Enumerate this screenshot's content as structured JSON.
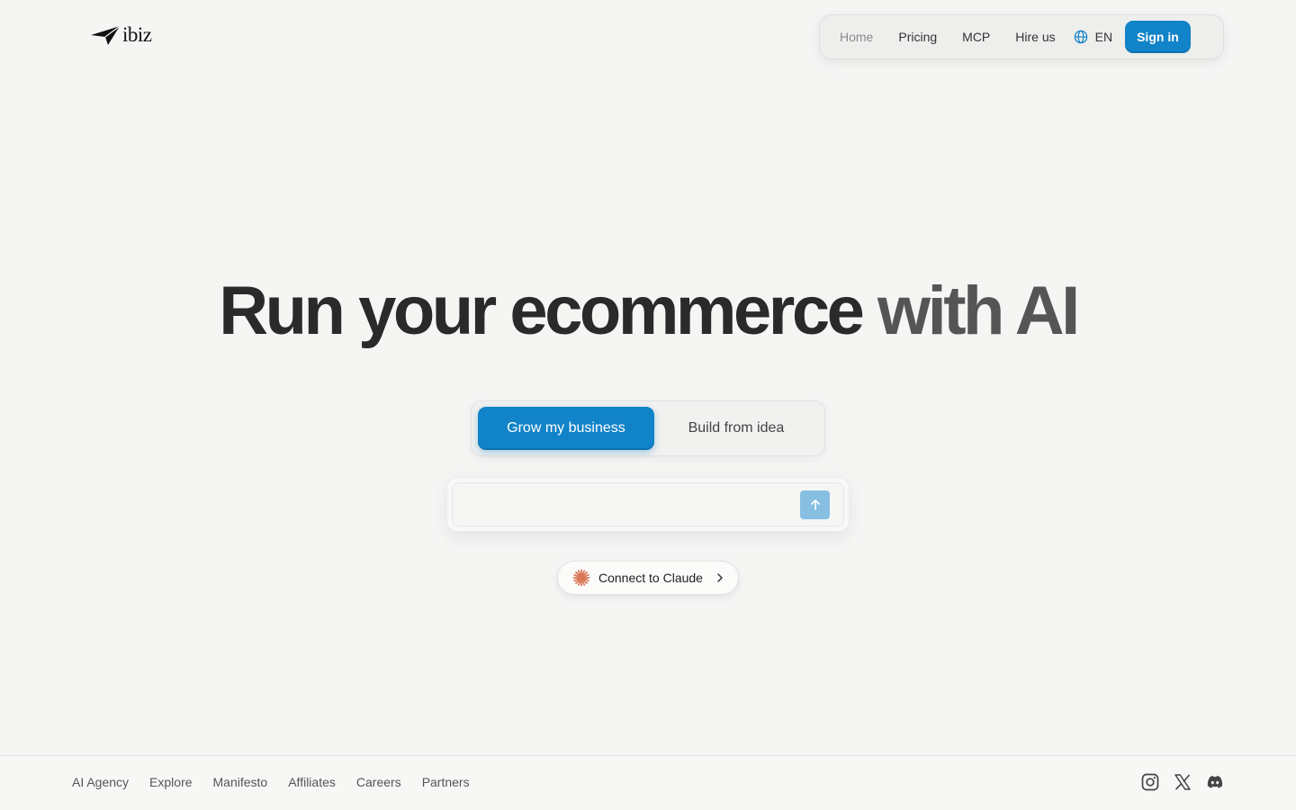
{
  "brand": {
    "name": "ibiz"
  },
  "nav": {
    "items": [
      {
        "label": "Home"
      },
      {
        "label": "Pricing"
      },
      {
        "label": "MCP"
      },
      {
        "label": "Hire us"
      }
    ],
    "language": "EN",
    "signin_label": "Sign in"
  },
  "hero": {
    "title_part1": "Run your ecommerce",
    "title_part2": "with AI"
  },
  "modes": {
    "active": "Grow my business",
    "inactive": "Build from idea"
  },
  "prompt": {
    "value": "",
    "placeholder": ""
  },
  "claude_button": {
    "label": "Connect to Claude"
  },
  "footer": {
    "links": [
      "AI Agency",
      "Explore",
      "Manifesto",
      "Affiliates",
      "Careers",
      "Partners"
    ],
    "socials": [
      "instagram-icon",
      "x-icon",
      "discord-icon"
    ]
  },
  "colors": {
    "accent": "#1183c8",
    "send_button": "#86bfe2",
    "background": "#f5f5f4"
  }
}
